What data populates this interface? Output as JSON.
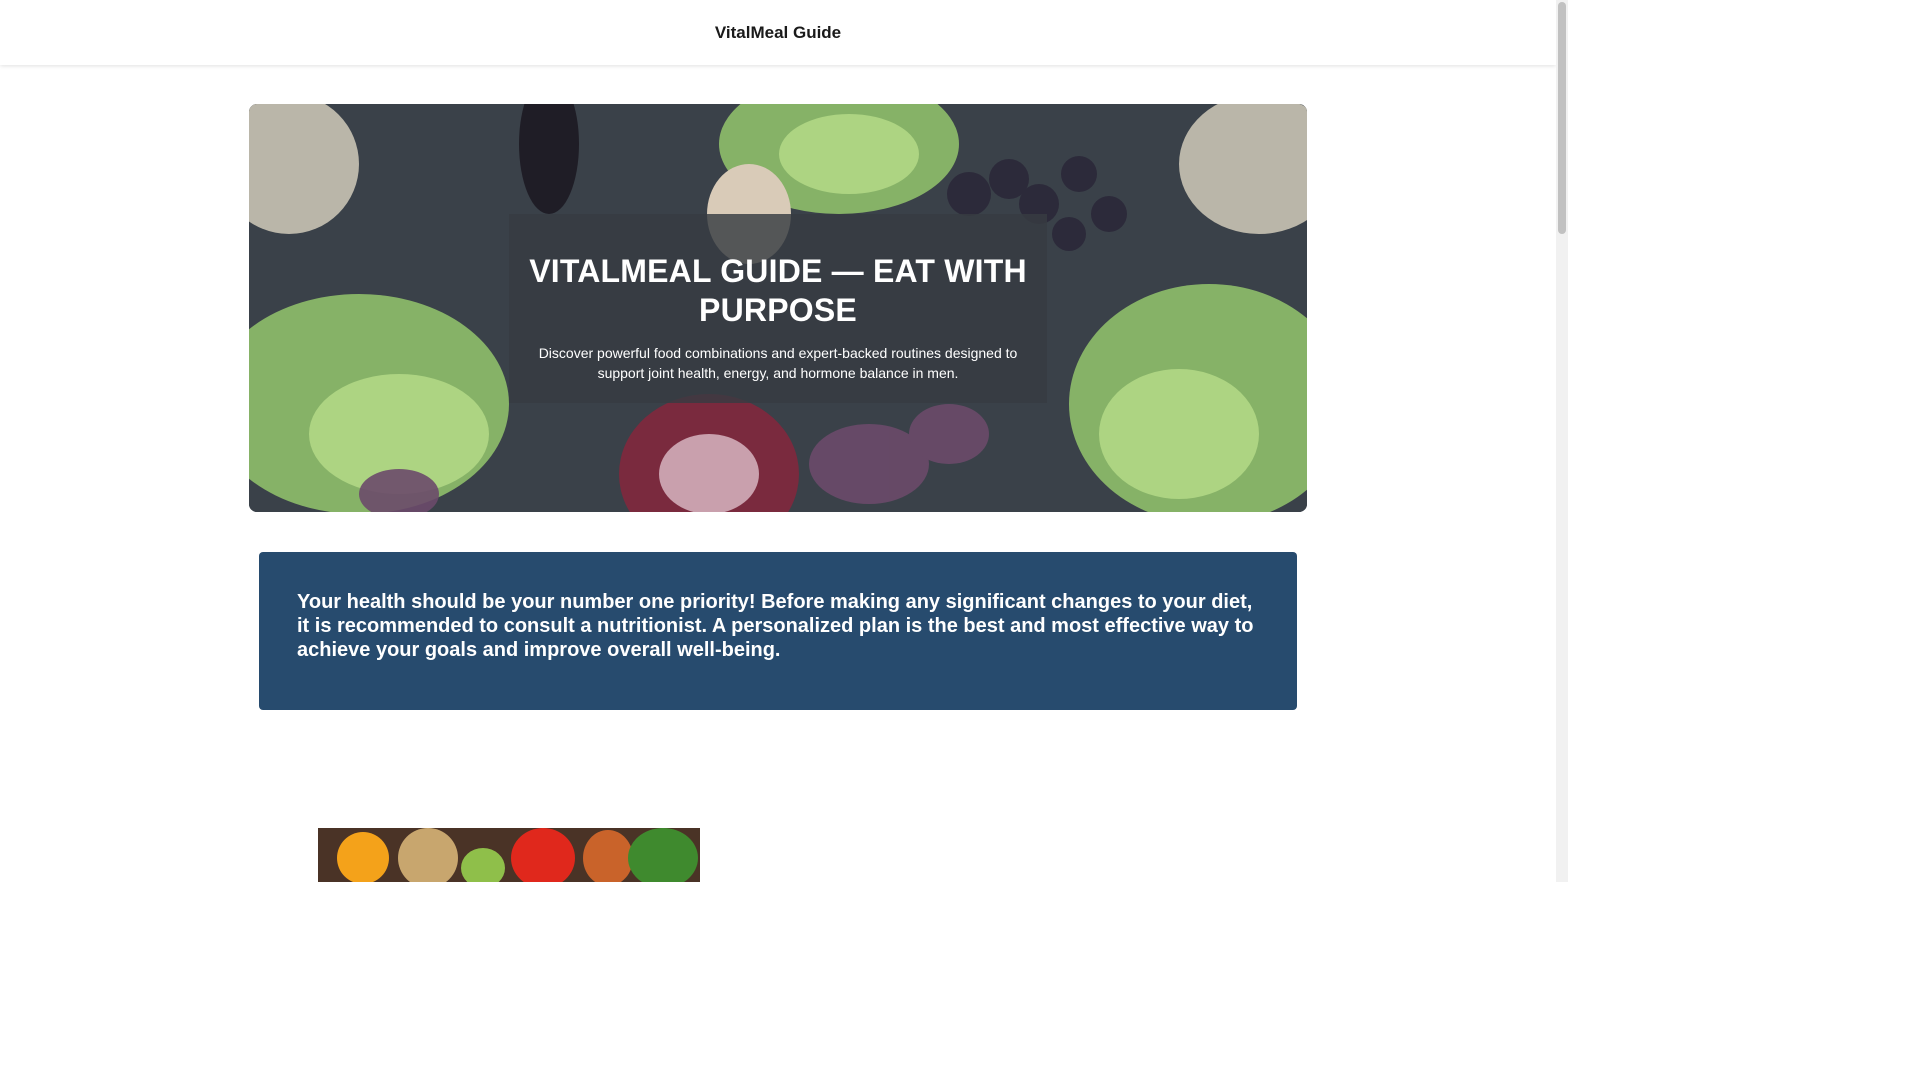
{
  "header": {
    "site_title": "VitalMeal Guide"
  },
  "hero": {
    "title": "VITALMEAL GUIDE — EAT WITH PURPOSE",
    "subtitle": "Discover powerful food combinations and expert-backed routines designed to support joint health, energy, and hormone balance in men."
  },
  "notice": {
    "text": "Your health should be your number one priority! Before making any significant changes to your diet, it is recommended to consult a nutritionist. A personalized plan is the best and most effective way to achieve your goals and improve overall well-being."
  },
  "colors": {
    "notice_background": "#274b6e",
    "hero_background": "#39414a"
  }
}
